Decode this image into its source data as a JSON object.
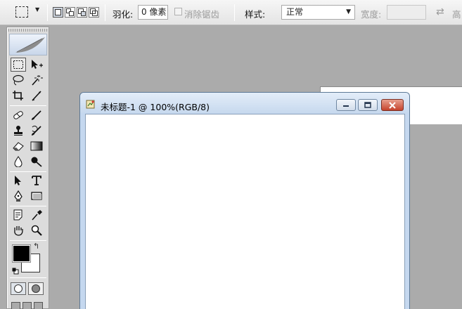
{
  "options_bar": {
    "tool_preset_icon": "rect-marquee-icon",
    "selection_modes": [
      "new-selection-icon",
      "add-to-selection-icon",
      "subtract-selection-icon",
      "intersect-selection-icon"
    ],
    "feather_label": "羽化:",
    "feather_value": "0 像素",
    "antialias_label": "消除锯齿",
    "antialias_checked": false,
    "style_label": "样式:",
    "style_value": "正常",
    "width_label": "宽度:",
    "width_value": "",
    "swap_icon": "swap-dimensions-icon",
    "height_label": "高"
  },
  "toolbox": {
    "logo_icon": "feather-logo-icon",
    "tools": [
      "rect-marquee-icon",
      "move-icon",
      "lasso-icon",
      "magic-wand-icon",
      "crop-icon",
      "slice-icon",
      "healing-brush-icon",
      "brush-icon",
      "clone-stamp-icon",
      "history-brush-icon",
      "eraser-icon",
      "gradient-icon",
      "blur-icon",
      "dodge-icon",
      "path-selection-icon",
      "type-icon",
      "pen-icon",
      "rectangle-shape-icon",
      "notes-icon",
      "eyedropper-icon",
      "hand-icon",
      "zoom-icon"
    ],
    "foreground_color": "#000000",
    "background_color": "#ffffff"
  },
  "document": {
    "title": "未标题-1 @ 100%(RGB/8)",
    "icon": "document-icon",
    "minimize_icon": "minimize-icon",
    "maximize_icon": "maximize-icon",
    "close_icon": "close-icon"
  },
  "colors": {
    "workspace": "#ababab",
    "canvas": "#ffffff",
    "titlebar": "#c7d9ee"
  }
}
